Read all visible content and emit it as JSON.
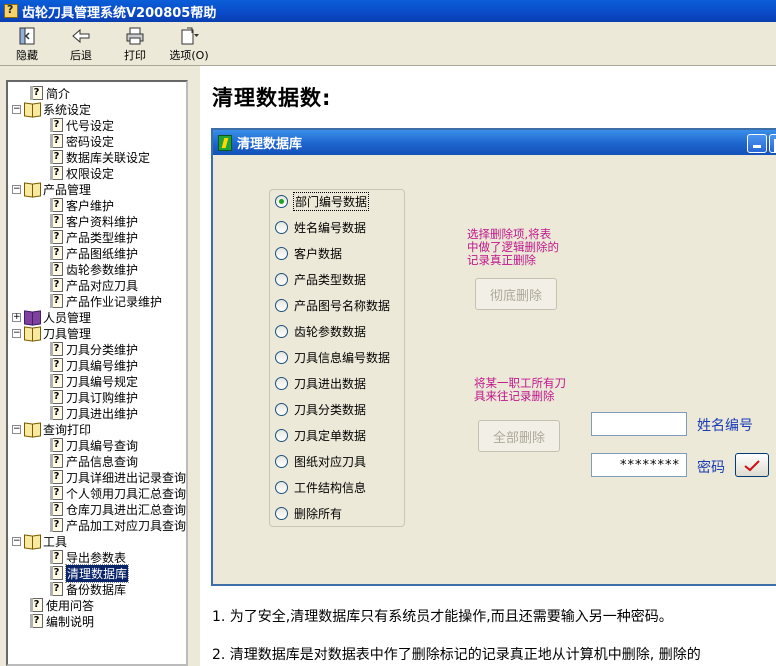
{
  "window": {
    "title": "齿轮刀具管理系统V200805帮助"
  },
  "toolbar": [
    {
      "label": "隐藏",
      "icon": "hide-icon"
    },
    {
      "label": "后退",
      "icon": "back-icon"
    },
    {
      "label": "打印",
      "icon": "print-icon"
    },
    {
      "label": "选项(O)",
      "icon": "options-icon"
    }
  ],
  "tree": [
    {
      "label": "简介",
      "type": "topic",
      "level": 0
    },
    {
      "label": "系统设定",
      "type": "book",
      "level": 0,
      "expanded": true
    },
    {
      "label": "代号设定",
      "type": "topic",
      "level": 1
    },
    {
      "label": "密码设定",
      "type": "topic",
      "level": 1
    },
    {
      "label": "数据库关联设定",
      "type": "topic",
      "level": 1
    },
    {
      "label": "权限设定",
      "type": "topic",
      "level": 1
    },
    {
      "label": "产品管理",
      "type": "book",
      "level": 0,
      "expanded": true
    },
    {
      "label": "客户维护",
      "type": "topic",
      "level": 1
    },
    {
      "label": "客户资料维护",
      "type": "topic",
      "level": 1
    },
    {
      "label": "产品类型维护",
      "type": "topic",
      "level": 1
    },
    {
      "label": "产品图纸维护",
      "type": "topic",
      "level": 1
    },
    {
      "label": "齿轮参数维护",
      "type": "topic",
      "level": 1
    },
    {
      "label": "产品对应刀具",
      "type": "topic",
      "level": 1
    },
    {
      "label": "产品作业记录维护",
      "type": "topic",
      "level": 1
    },
    {
      "label": "人员管理",
      "type": "book-closed",
      "level": 0,
      "expanded": false
    },
    {
      "label": "刀具管理",
      "type": "book",
      "level": 0,
      "expanded": true
    },
    {
      "label": "刀具分类维护",
      "type": "topic",
      "level": 1
    },
    {
      "label": "刀具编号维护",
      "type": "topic",
      "level": 1
    },
    {
      "label": "刀具编号规定",
      "type": "topic",
      "level": 1
    },
    {
      "label": "刀具订购维护",
      "type": "topic",
      "level": 1
    },
    {
      "label": "刀具进出维护",
      "type": "topic",
      "level": 1
    },
    {
      "label": "查询打印",
      "type": "book",
      "level": 0,
      "expanded": true
    },
    {
      "label": "刀具编号查询",
      "type": "topic",
      "level": 1
    },
    {
      "label": "产品信息查询",
      "type": "topic",
      "level": 1
    },
    {
      "label": "刀具详细进出记录查询",
      "type": "topic",
      "level": 1
    },
    {
      "label": "个人领用刀具汇总查询",
      "type": "topic",
      "level": 1
    },
    {
      "label": "仓库刀具进出汇总查询",
      "type": "topic",
      "level": 1
    },
    {
      "label": "产品加工对应刀具查询",
      "type": "topic",
      "level": 1
    },
    {
      "label": "工具",
      "type": "book",
      "level": 0,
      "expanded": true
    },
    {
      "label": "导出参数表",
      "type": "topic",
      "level": 1
    },
    {
      "label": "清理数据库",
      "type": "topic",
      "level": 1,
      "selected": true
    },
    {
      "label": "备份数据库",
      "type": "topic",
      "level": 1
    },
    {
      "label": "使用问答",
      "type": "topic",
      "level": 0
    },
    {
      "label": "编制说明",
      "type": "topic",
      "level": 0
    }
  ],
  "content": {
    "title": "清理数据数:",
    "dialog": {
      "title": "清理数据库",
      "options": [
        {
          "label": "部门编号数据",
          "selected": true
        },
        {
          "label": "姓名编号数据",
          "selected": false
        },
        {
          "label": "客户数据",
          "selected": false
        },
        {
          "label": "产品类型数据",
          "selected": false
        },
        {
          "label": "产品图号名称数据",
          "selected": false
        },
        {
          "label": "齿轮参数数据",
          "selected": false
        },
        {
          "label": "刀具信息编号数据",
          "selected": false
        },
        {
          "label": "刀具进出数据",
          "selected": false
        },
        {
          "label": "刀具分类数据",
          "selected": false
        },
        {
          "label": "刀具定单数据",
          "selected": false
        },
        {
          "label": "图纸对应刀具",
          "selected": false
        },
        {
          "label": "工件结构信息",
          "selected": false
        },
        {
          "label": "删除所有",
          "selected": false
        }
      ],
      "note1": [
        "选择删除项,将表",
        "中做了逻辑删除的",
        "记录真正删除"
      ],
      "note2": [
        "将某一职工所有刀",
        "具来往记录删除"
      ],
      "purge_button": "彻底删除",
      "delete_all_button": "全部删除",
      "name_code_label": "姓名编号",
      "name_code_value": "",
      "password_label": "密码",
      "password_value": "********"
    },
    "paragraphs": [
      "1.  为了安全,清理数据库只有系统员才能操作,而且还需要输入另一种密码。",
      "2.  清理数据库是对数据表中作了删除标记的记录真正地从计算机中删除, 删除的"
    ]
  },
  "colors": {
    "note": "#c0168c",
    "label_blue": "#1a3bb5",
    "title_bar": "#0b49c7"
  }
}
